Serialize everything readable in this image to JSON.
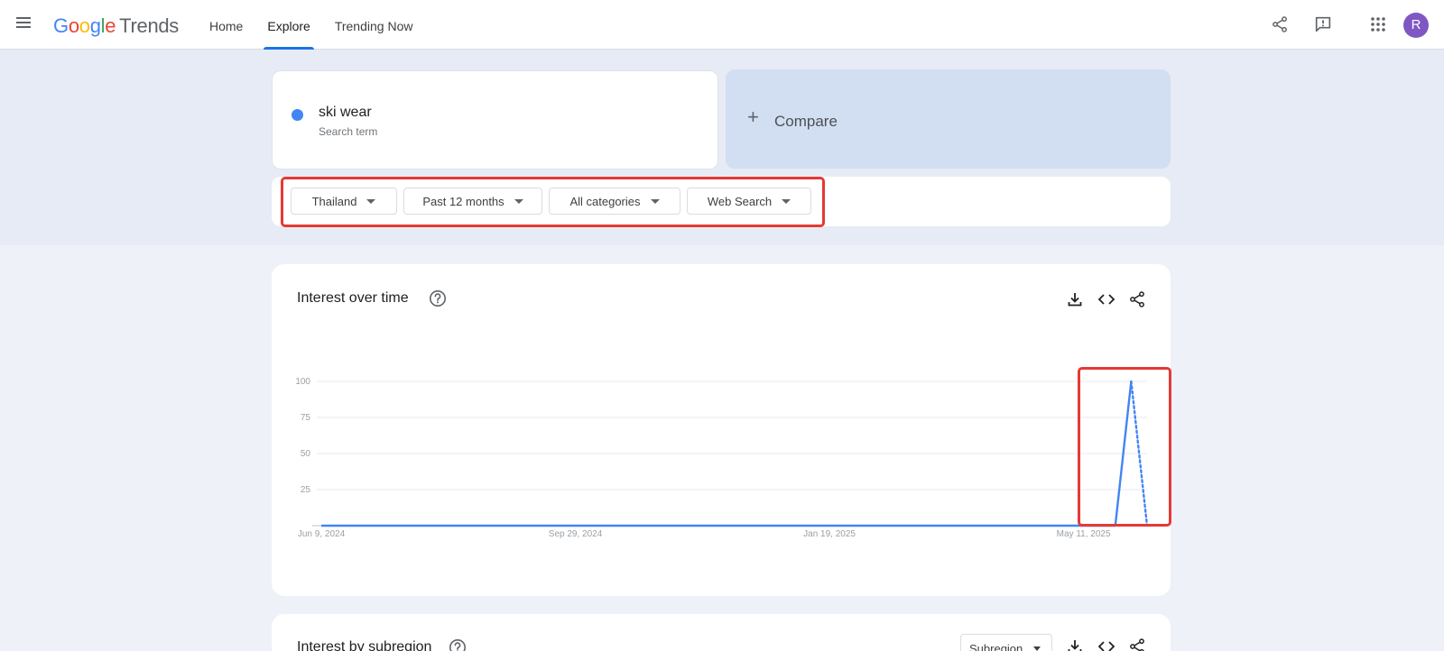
{
  "header": {
    "logo": {
      "g1": "G",
      "o1": "o",
      "o2": "o",
      "g2": "g",
      "l": "l",
      "e": "e",
      "product": "Trends"
    },
    "nav": [
      {
        "label": "Home",
        "active": false
      },
      {
        "label": "Explore",
        "active": true
      },
      {
        "label": "Trending Now",
        "active": false
      }
    ],
    "avatar_initial": "R",
    "icons": [
      "menu-icon",
      "share-icon",
      "feedback-icon",
      "apps-icon"
    ]
  },
  "search": {
    "term": "ski wear",
    "term_type": "Search term",
    "term_color": "#4285f4",
    "compare_label": "Compare"
  },
  "filters": [
    {
      "label": "Thailand"
    },
    {
      "label": "Past 12 months"
    },
    {
      "label": "All categories"
    },
    {
      "label": "Web Search"
    }
  ],
  "interest_over_time": {
    "title": "Interest over time",
    "tools": [
      "download-icon",
      "embed-icon",
      "share-icon"
    ]
  },
  "chart_data": {
    "type": "line",
    "title": "Interest over time",
    "xlabel": "",
    "ylabel": "",
    "ylim": [
      0,
      100
    ],
    "yticks": [
      "100",
      "75",
      "50",
      "25"
    ],
    "xticks": [
      "Jun 9, 2024",
      "Sep 29, 2024",
      "Jan 19, 2025",
      "May 11, 2025"
    ],
    "x_range": [
      "2024-06-09",
      "2025-06-08"
    ],
    "grid": true,
    "color": "#4285f4",
    "series": [
      {
        "points": [
          {
            "x": "2024-06-09",
            "y": 0
          },
          {
            "x": "2025-05-25",
            "y": 0
          },
          {
            "x": "2025-06-01",
            "y": 100
          }
        ]
      },
      {
        "style": "dotted",
        "points": [
          {
            "x": "2025-06-01",
            "y": 100
          },
          {
            "x": "2025-06-08",
            "y": 0
          }
        ]
      }
    ]
  },
  "interest_by_subregion": {
    "title": "Interest by subregion",
    "select_value": "Subregion"
  }
}
